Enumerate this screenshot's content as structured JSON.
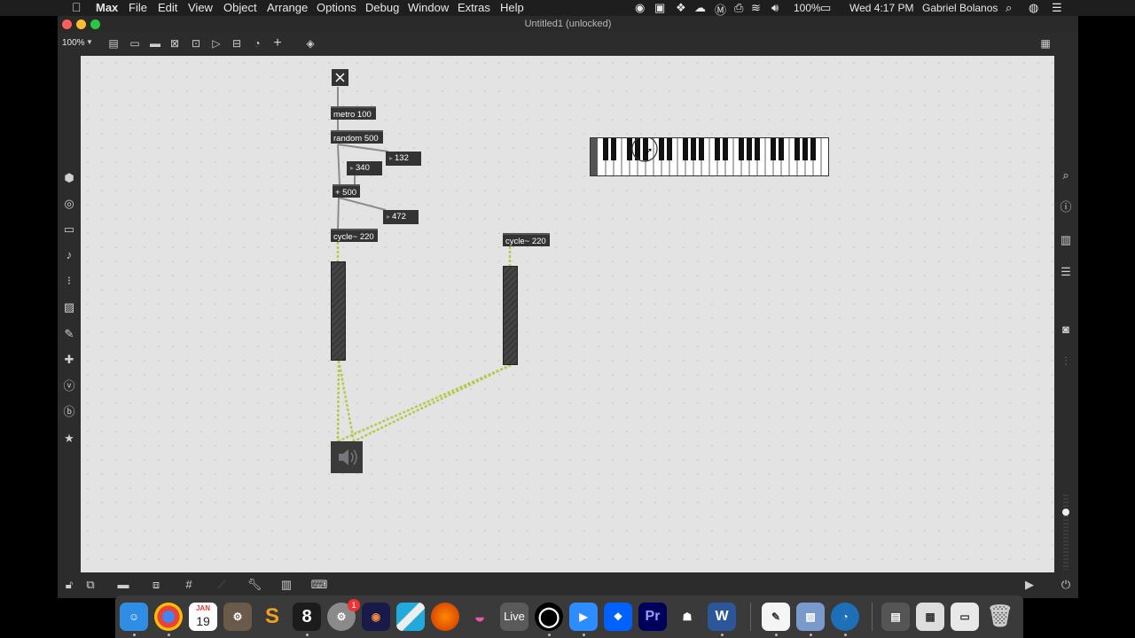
{
  "menubar": {
    "app": "Max",
    "items": [
      "File",
      "Edit",
      "View",
      "Object",
      "Arrange",
      "Options",
      "Debug",
      "Window",
      "Extras",
      "Help"
    ],
    "battery": "100%",
    "clock": "Wed 4:17 PM",
    "user": "Gabriel Bolanos"
  },
  "window": {
    "title": "Untitled1 (unlocked)",
    "zoom": "100%"
  },
  "patch": {
    "metro": "metro 100",
    "random": "random 500",
    "num1": "132",
    "num2": "340",
    "plus": "+ 500",
    "num3": "472",
    "cycle1": "cycle~ 220",
    "cycle2": "cycle~ 220"
  },
  "dock": {
    "calendar_month": "JAN",
    "calendar_day": "19",
    "badge": "1",
    "live": "Live",
    "premiere": "Pr",
    "word": "W"
  },
  "colors": {
    "canvas": "#e3e3e3",
    "object": "#333333",
    "signal_patch": "#b7c84a"
  }
}
